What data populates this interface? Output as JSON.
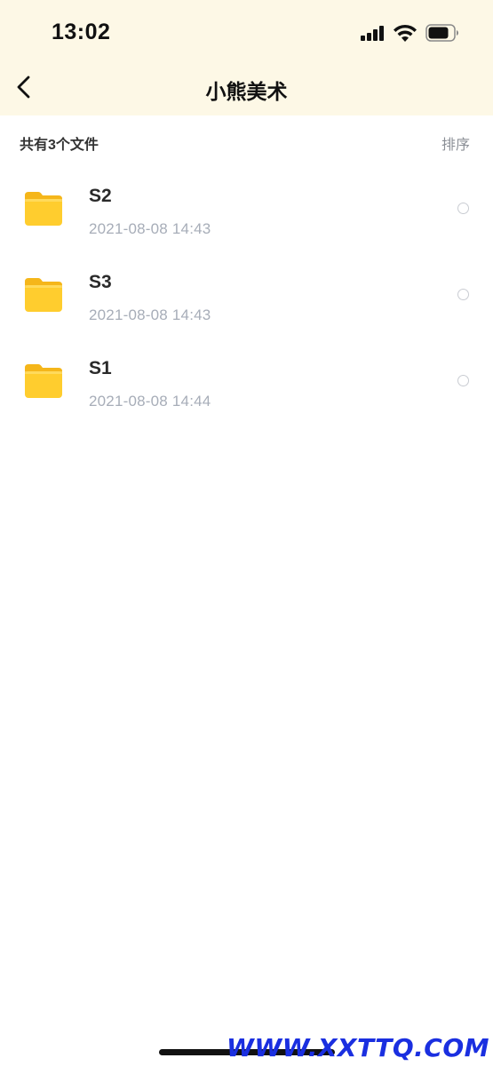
{
  "status_bar": {
    "time": "13:02",
    "icons": [
      "cellular-signal-icon",
      "wifi-icon",
      "battery-icon"
    ]
  },
  "nav": {
    "back_icon": "chevron-left-icon",
    "title": "小熊美术"
  },
  "info": {
    "count_text": "共有3个文件",
    "sort_label": "排序"
  },
  "files": [
    {
      "name": "S2",
      "date": "2021-08-08 14:43",
      "icon": "folder-icon"
    },
    {
      "name": "S3",
      "date": "2021-08-08 14:43",
      "icon": "folder-icon"
    },
    {
      "name": "S1",
      "date": "2021-08-08 14:44",
      "icon": "folder-icon"
    }
  ],
  "watermark": "WWW.XXTTQ.COM",
  "colors": {
    "header_bg": "#fdf8e6",
    "folder_yellow": "#ffc928",
    "date_gray": "#a7adb8",
    "watermark_blue": "#1a2fe0"
  }
}
